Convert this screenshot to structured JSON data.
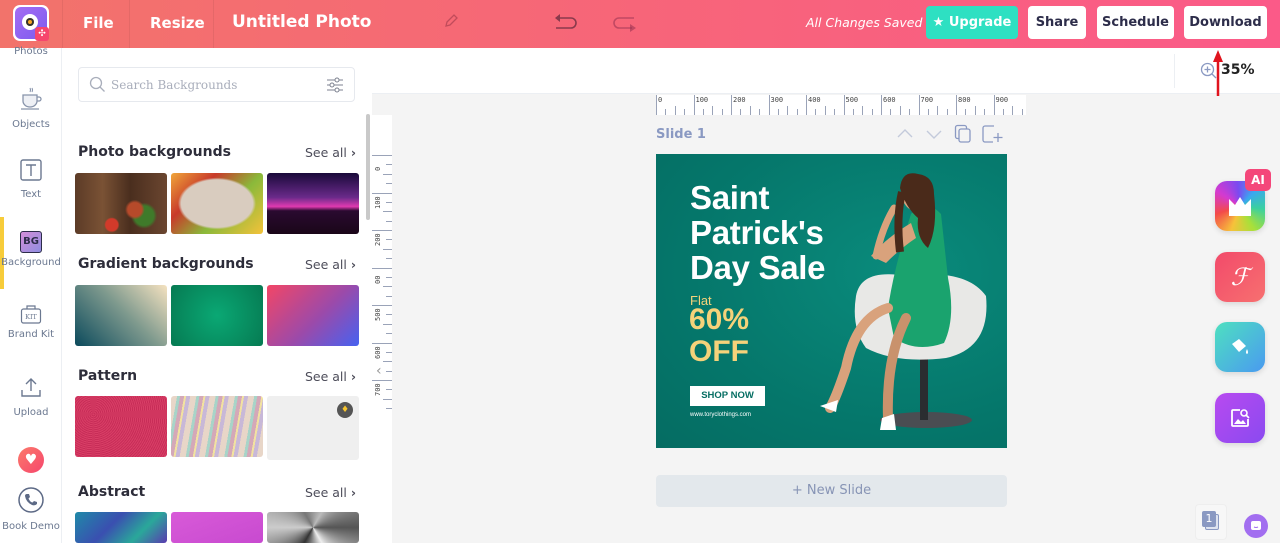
{
  "topbar": {
    "menu": [
      "File",
      "Resize"
    ],
    "document_title": "Untitled Photo",
    "save_status": "All Changes Saved",
    "buttons": {
      "upgrade": "Upgrade",
      "share": "Share",
      "schedule": "Schedule",
      "download": "Download"
    }
  },
  "rail": {
    "items": [
      {
        "label": "Photos",
        "icon": "photos-icon"
      },
      {
        "label": "Objects",
        "icon": "cup-icon"
      },
      {
        "label": "Text",
        "icon": "text-icon"
      },
      {
        "label": "Background",
        "icon": "bg-icon",
        "active": true,
        "badge": "BG"
      },
      {
        "label": "Brand Kit",
        "icon": "brand-kit-icon",
        "badge": "KIT"
      },
      {
        "label": "Upload",
        "icon": "upload-icon"
      },
      {
        "label": "",
        "icon": "heart-icon"
      },
      {
        "label": "Book Demo",
        "icon": "phone-icon"
      }
    ],
    "active_color": "#f7cc3a"
  },
  "panel": {
    "search_placeholder": "Search Backgrounds",
    "see_all": "See all",
    "sections": [
      {
        "title": "Photo backgrounds"
      },
      {
        "title": "Gradient backgrounds"
      },
      {
        "title": "Pattern"
      },
      {
        "title": "Abstract"
      }
    ]
  },
  "workspace": {
    "zoom": "35%",
    "ruler_h": [
      "0",
      "100",
      "200",
      "300",
      "400",
      "500",
      "600",
      "700",
      "800",
      "900"
    ],
    "ruler_v": [
      "0",
      "100",
      "200",
      "00",
      "500",
      "600",
      "700"
    ],
    "slide_label": "Slide 1",
    "new_slide": "+ New Slide",
    "page_count": "1"
  },
  "slide": {
    "headline_lines": [
      "Saint",
      "Patrick's",
      "Day Sale"
    ],
    "flat": "Flat",
    "discount_lines": [
      "60%",
      "OFF"
    ],
    "cta": "SHOP NOW",
    "url": "www.toryclothings.com",
    "bg_color": "#05776b",
    "accent_color": "#f5d27a"
  },
  "right_apps": {
    "ai_badge": "AI",
    "apps": [
      "magic-ai-app",
      "font-app",
      "paint-bucket-app",
      "image-search-app"
    ]
  },
  "colors": {
    "brand_gradient_start": "#f2736b",
    "brand_gradient_end": "#fb5a88",
    "upgrade": "#2ee0c2"
  }
}
